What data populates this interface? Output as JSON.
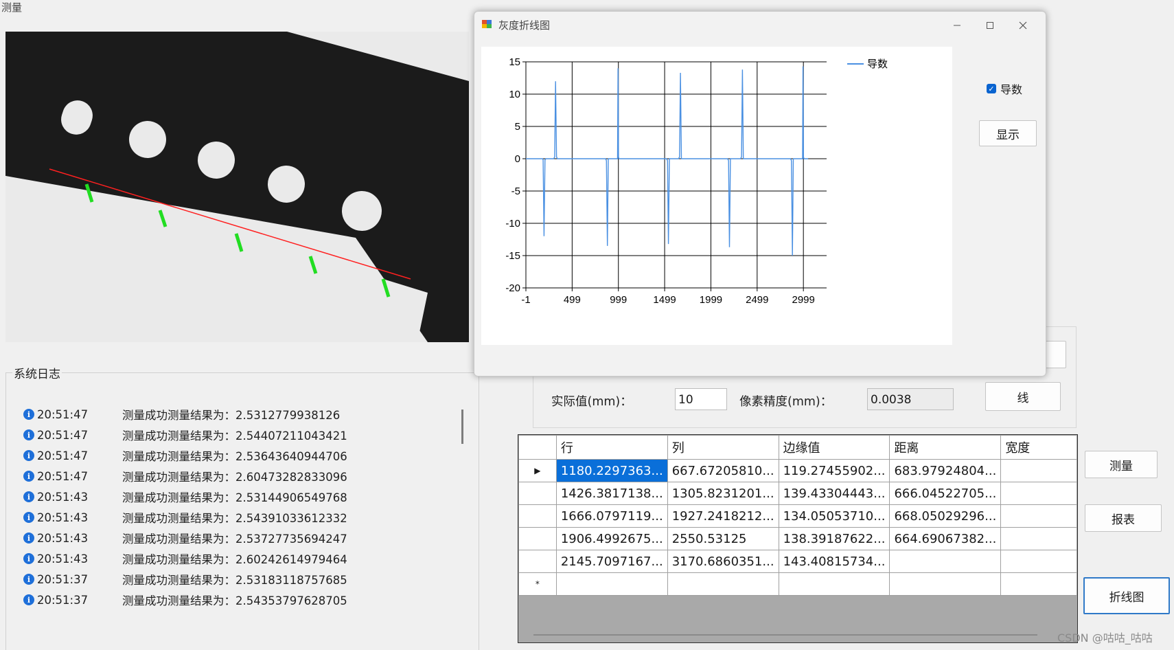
{
  "main_window": {
    "title": "测量"
  },
  "log": {
    "title": "系统日志",
    "entries": [
      {
        "time": "20:51:47",
        "message": "测量成功测量结果为：2.5312779938126"
      },
      {
        "time": "20:51:47",
        "message": "测量成功测量结果为：2.54407211043421"
      },
      {
        "time": "20:51:47",
        "message": "测量成功测量结果为：2.53643640944706"
      },
      {
        "time": "20:51:47",
        "message": "测量成功测量结果为：2.60473282833096"
      },
      {
        "time": "20:51:43",
        "message": "测量成功测量结果为：2.53144906549768"
      },
      {
        "time": "20:51:43",
        "message": "测量成功测量结果为：2.54391033612332"
      },
      {
        "time": "20:51:43",
        "message": "测量成功测量结果为：2.53727735694247"
      },
      {
        "time": "20:51:43",
        "message": "测量成功测量结果为：2.60242614979464"
      },
      {
        "time": "20:51:37",
        "message": "测量成功测量结果为：2.53183118757685"
      },
      {
        "time": "20:51:37",
        "message": "测量成功测量结果为：2.54353797628705"
      }
    ]
  },
  "params": {
    "actual_label": "实际值(mm)：",
    "actual_value": "10",
    "precision_label": "像素精度(mm)：",
    "precision_value": "0.0038",
    "line_button": "线"
  },
  "table": {
    "columns": [
      "行",
      "列",
      "边缘值",
      "距离",
      "宽度"
    ],
    "rows": [
      [
        "1180.2297363...",
        "667.67205810...",
        "119.27455902...",
        "683.97924804...",
        ""
      ],
      [
        "1426.3817138...",
        "1305.8231201...",
        "139.43304443...",
        "666.04522705...",
        ""
      ],
      [
        "1666.0797119...",
        "1927.2418212...",
        "134.05053710...",
        "668.05029296...",
        ""
      ],
      [
        "1906.4992675...",
        "2550.53125",
        "138.39187622...",
        "664.69067382...",
        ""
      ],
      [
        "2145.7097167...",
        "3170.6860351...",
        "143.40815734...",
        "",
        ""
      ]
    ]
  },
  "buttons": {
    "measure": "测量",
    "report": "报表",
    "line_chart": "折线图"
  },
  "dialog": {
    "title": "灰度折线图",
    "checkbox_label": "导数",
    "checkbox_checked": true,
    "show_button": "显示",
    "icons": {
      "minimize": "minimize-icon",
      "maximize": "maximize-icon",
      "close": "close-icon"
    }
  },
  "chart_data": {
    "type": "line",
    "title": "",
    "xlabel": "",
    "ylabel": "",
    "xlim": [
      -1,
      3250
    ],
    "ylim": [
      -20,
      15
    ],
    "x_ticks": [
      "-1",
      "499",
      "999",
      "1499",
      "1999",
      "2499",
      "2999"
    ],
    "y_ticks": [
      "15",
      "10",
      "5",
      "0",
      "-5",
      "-10",
      "-15",
      "-20"
    ],
    "grid": true,
    "legend_position": "top-right",
    "color": "#4a90e2",
    "series": [
      {
        "name": "导数",
        "x": [
          -1,
          180,
          185,
          195,
          205,
          215,
          300,
          310,
          320,
          330,
          340,
          860,
          870,
          880,
          890,
          990,
          995,
          1000,
          1005,
          1520,
          1530,
          1540,
          1550,
          1650,
          1660,
          1670,
          1680,
          2180,
          2190,
          2200,
          2210,
          2320,
          2330,
          2340,
          2350,
          2860,
          2870,
          2880,
          2890,
          2990,
          2995,
          3000,
          3005,
          3050
        ],
        "y": [
          0,
          0,
          -0.2,
          -12,
          -0.2,
          0,
          0,
          0.3,
          12,
          0.3,
          0,
          0,
          -0.3,
          -13.5,
          0,
          0,
          14,
          0.3,
          0,
          0,
          -0.3,
          -13.2,
          0,
          0,
          0.3,
          13.3,
          0,
          0,
          -0.3,
          -13.7,
          0,
          0,
          0.3,
          13.8,
          0,
          0,
          -0.3,
          -15,
          0,
          0,
          14.3,
          0.3,
          0,
          0
        ]
      }
    ]
  },
  "watermark": "CSDN @咕咕_咕咕"
}
